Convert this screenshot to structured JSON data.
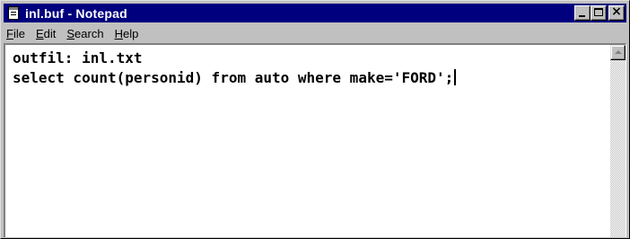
{
  "window": {
    "title": "inl.buf - Notepad"
  },
  "icons": {
    "app": "notepad-icon",
    "minimize": "minimize-icon",
    "maximize": "maximize-icon",
    "close": "close-icon",
    "scroll_up": "arrow-up-icon"
  },
  "caption": {
    "close_glyph": "×"
  },
  "menu": {
    "items": [
      {
        "mnemonic": "F",
        "rest": "ile"
      },
      {
        "mnemonic": "E",
        "rest": "dit"
      },
      {
        "mnemonic": "S",
        "rest": "earch"
      },
      {
        "mnemonic": "H",
        "rest": "elp"
      }
    ]
  },
  "editor": {
    "lines": [
      "outfil: inl.txt",
      "select count(personid) from auto where make='FORD';"
    ]
  },
  "colors": {
    "titlebar": "#00007f",
    "face": "#c0c0c0",
    "text_bg": "#ffffff"
  }
}
